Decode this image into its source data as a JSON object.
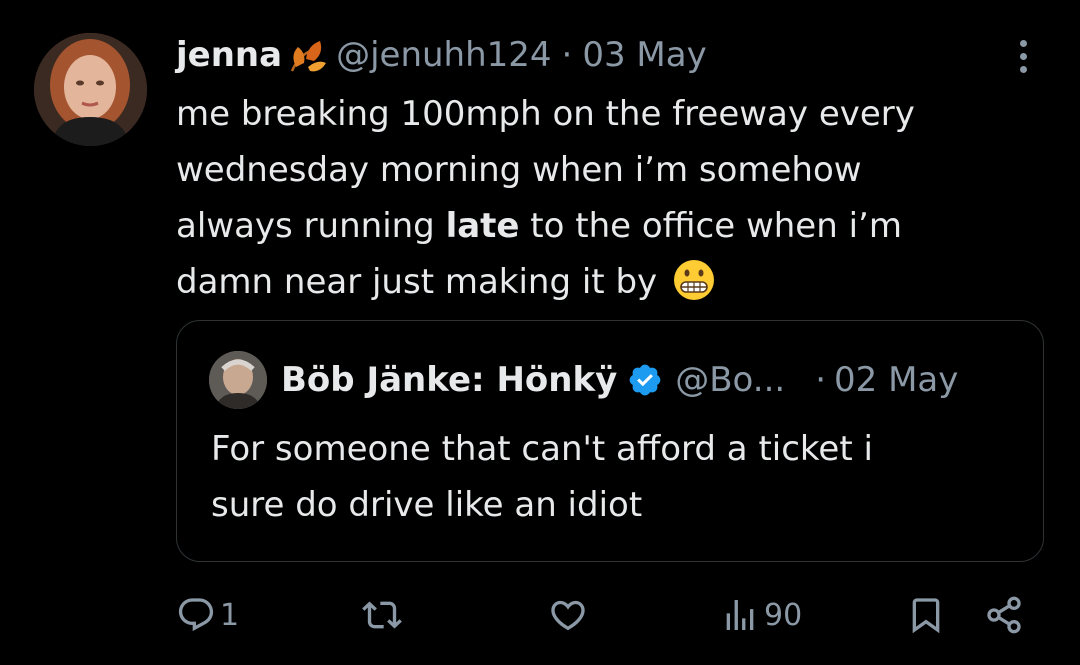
{
  "author": {
    "display_name": "jenna",
    "name_emoji": "fallen-leaf-emoji",
    "handle": "@jenuhh124",
    "separator": "·",
    "date": "03 May"
  },
  "tweet": {
    "text_line1": "me breaking 100mph on the freeway every",
    "text_line2": "wednesday morning when i’m somehow",
    "text_line3_before": "always running ",
    "text_line3_bold": "late",
    "text_line3_after": " to the office when i’m",
    "text_line4": "damn near just making it by",
    "trailing_emoji": "grimacing-face-emoji"
  },
  "quoted_tweet": {
    "display_name": "Böb Jänke: Hönkÿ",
    "verified": true,
    "handle": "@Bo...",
    "separator": "·",
    "date": "02 May",
    "text_line1": "For someone that can't afford a ticket i",
    "text_line2": "sure do drive like an idiot"
  },
  "actions": {
    "reply_count": "1",
    "retweet_count": "",
    "like_count": "",
    "views_count": "90"
  },
  "colors": {
    "background": "#000000",
    "text_primary": "#e7e9ea",
    "text_secondary": "#8b98a5",
    "border": "#2f3336",
    "verified_blue": "#1d9bf0"
  }
}
